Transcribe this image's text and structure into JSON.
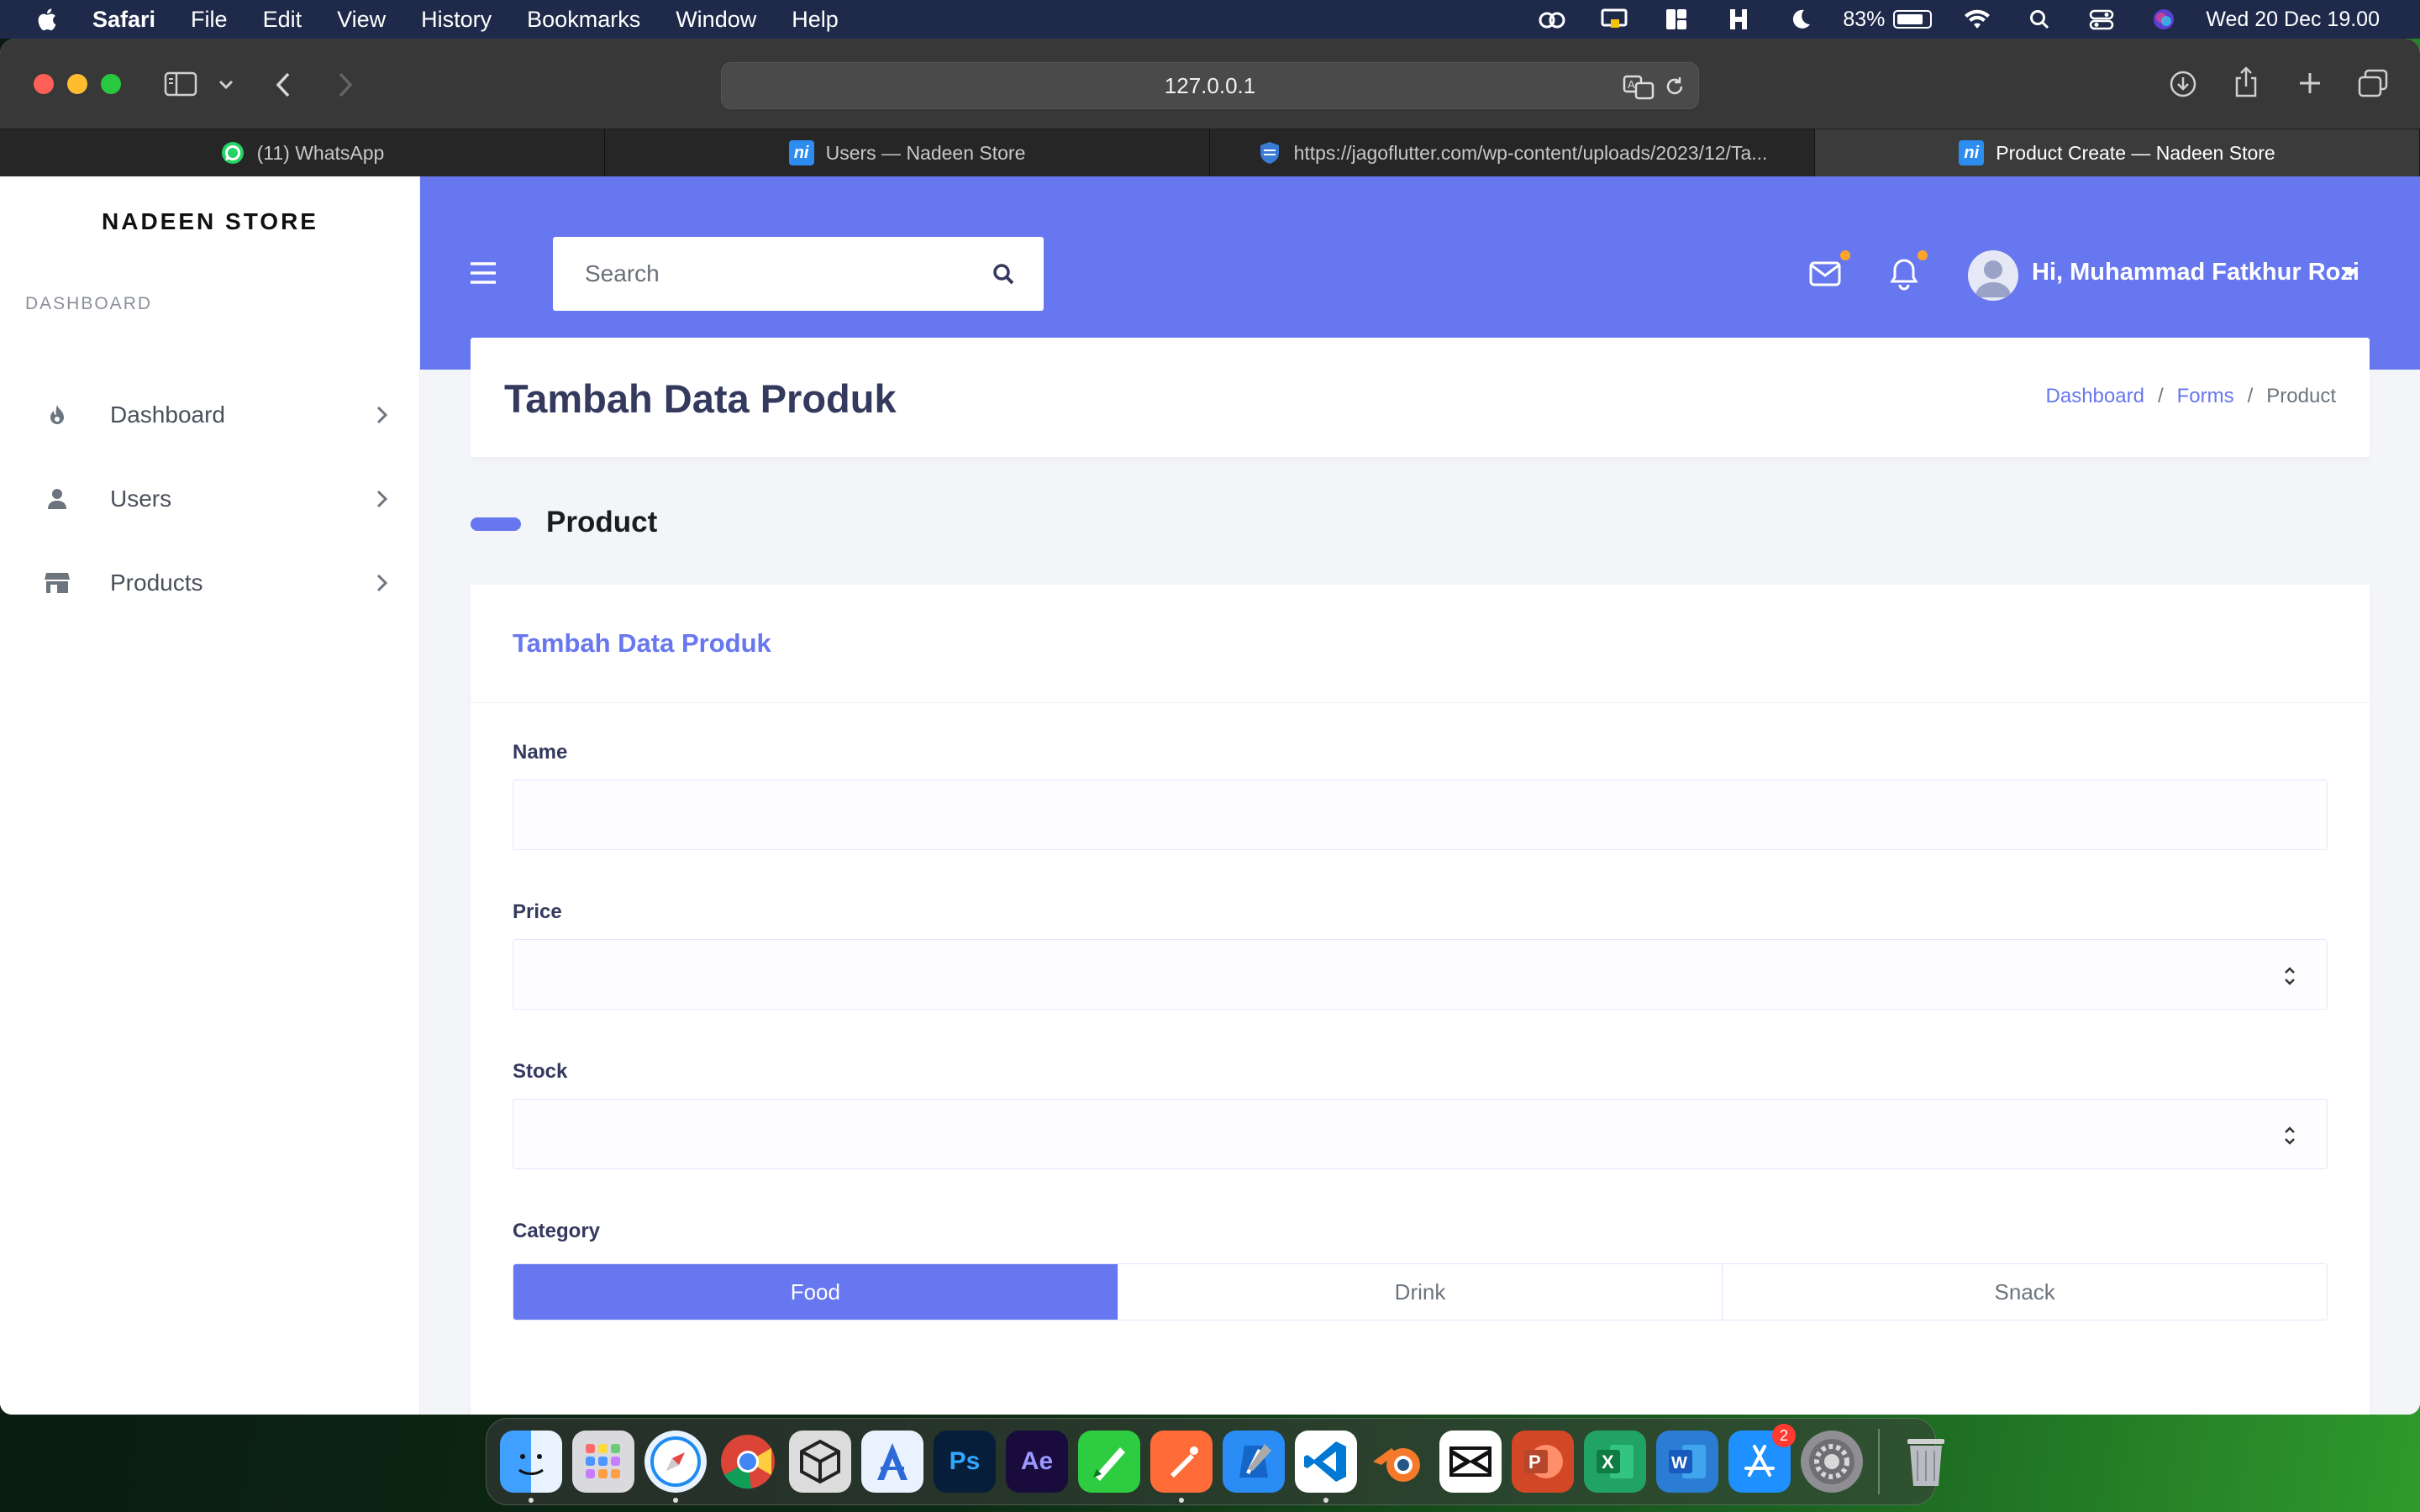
{
  "menubar": {
    "app_name": "Safari",
    "items": [
      "File",
      "Edit",
      "View",
      "History",
      "Bookmarks",
      "Window",
      "Help"
    ],
    "battery": "83%",
    "datetime": "Wed 20 Dec  19.00"
  },
  "browser": {
    "url": "127.0.0.1",
    "tabs": [
      {
        "label": "(11) WhatsApp",
        "icon": "whatsapp-icon"
      },
      {
        "label": "Users — Nadeen Store",
        "icon": "nadeen-favicon"
      },
      {
        "label": "https://jagoflutter.com/wp-content/uploads/2023/12/Ta...",
        "icon": "jagoflutter-favicon"
      },
      {
        "label": "Product Create — Nadeen Store",
        "icon": "nadeen-favicon",
        "active": true
      }
    ]
  },
  "sidebar": {
    "brand": "NADEEN STORE",
    "section": "DASHBOARD",
    "items": [
      {
        "label": "Dashboard",
        "icon": "fire-icon"
      },
      {
        "label": "Users",
        "icon": "user-icon"
      },
      {
        "label": "Products",
        "icon": "store-icon"
      }
    ]
  },
  "header": {
    "search_placeholder": "Search",
    "greeting": "Hi, Muhammad Fatkhur Rozi"
  },
  "section_header": {
    "title": "Tambah Data Produk",
    "breadcrumb": [
      "Dashboard",
      "Forms",
      "Product"
    ]
  },
  "section": {
    "title": "Product"
  },
  "card": {
    "title": "Tambah Data Produk",
    "fields": {
      "name_label": "Name",
      "price_label": "Price",
      "stock_label": "Stock",
      "category_label": "Category"
    },
    "categories": [
      "Food",
      "Drink",
      "Snack"
    ],
    "selected_category": "Food"
  },
  "colors": {
    "primary": "#6777ef",
    "sidebar_bg": "#ffffff",
    "page_bg": "#f4f5f9",
    "notification_dot": "#ffa426"
  },
  "dock": {
    "apps": [
      "Finder",
      "Launchpad",
      "Safari",
      "Chrome",
      "Unity",
      "Instruments",
      "Photoshop",
      "After Effects",
      "Vectornator",
      "Postman",
      "Xcode",
      "VS Code",
      "Blender",
      "CapCut",
      "PowerPoint",
      "Excel",
      "Word",
      "App Store",
      "System Settings",
      "Trash"
    ],
    "app_store_badge": "2"
  }
}
